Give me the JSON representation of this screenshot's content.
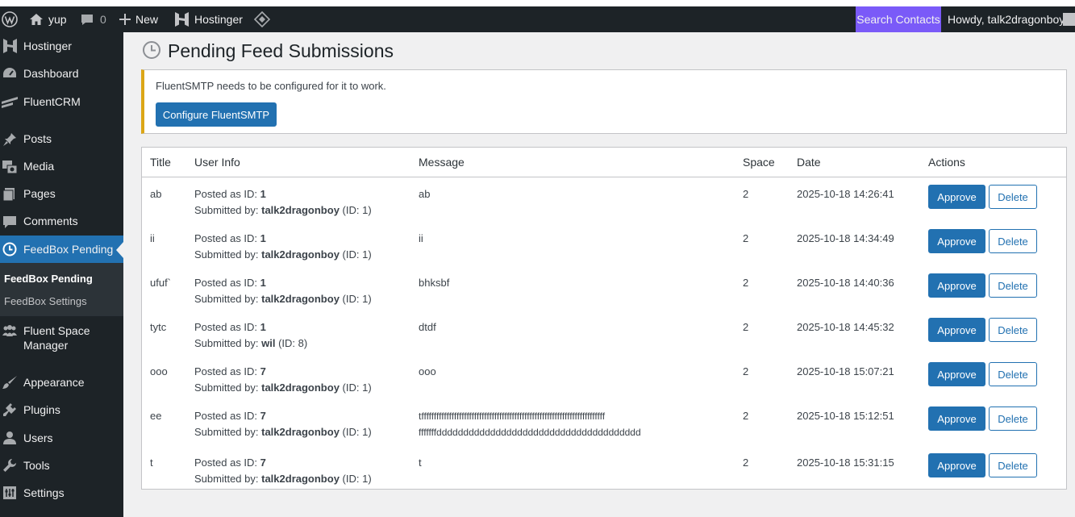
{
  "admin_bar": {
    "site_name": "yup",
    "comments_count": "0",
    "new_label": "New",
    "hostinger_label": "Hostinger",
    "search_contacts_label": "Search Contacts",
    "howdy_label": "Howdy, talk2dragonboy"
  },
  "sidebar": {
    "items": [
      {
        "label": "Hostinger",
        "icon": "hostinger-icon"
      },
      {
        "label": "Dashboard",
        "icon": "dashboard-icon"
      },
      {
        "label": "FluentCRM",
        "icon": "fluentcrm-icon"
      },
      {
        "label": "Posts",
        "icon": "pin-icon"
      },
      {
        "label": "Media",
        "icon": "media-icon"
      },
      {
        "label": "Pages",
        "icon": "pages-icon"
      },
      {
        "label": "Comments",
        "icon": "comments-icon"
      },
      {
        "label": "FeedBox Pending",
        "icon": "clock-icon"
      },
      {
        "label": "Fluent Space Manager",
        "icon": "groups-icon"
      },
      {
        "label": "Appearance",
        "icon": "brush-icon"
      },
      {
        "label": "Plugins",
        "icon": "plugin-icon"
      },
      {
        "label": "Users",
        "icon": "user-icon"
      },
      {
        "label": "Tools",
        "icon": "wrench-icon"
      },
      {
        "label": "Settings",
        "icon": "settings-icon"
      }
    ],
    "submenu": [
      {
        "label": "FeedBox Pending"
      },
      {
        "label": "FeedBox Settings"
      }
    ]
  },
  "page": {
    "title": "Pending Feed Submissions"
  },
  "notice": {
    "text": "FluentSMTP needs to be configured for it to work.",
    "button_label": "Configure FluentSMTP"
  },
  "table": {
    "columns": [
      "Title",
      "User Info",
      "Message",
      "Space",
      "Date",
      "Actions"
    ],
    "posted_prefix": "Posted as ID:",
    "submitted_prefix": "Submitted by:",
    "approve_label": "Approve",
    "delete_label": "Delete",
    "rows": [
      {
        "title": "ab",
        "posted_id": "1",
        "user": "talk2dragonboy",
        "user_id": "(ID: 1)",
        "message": "ab",
        "message2": "",
        "space": "2",
        "date": "2025-10-18 14:26:41"
      },
      {
        "title": "ii",
        "posted_id": "1",
        "user": "talk2dragonboy",
        "user_id": "(ID: 1)",
        "message": "ii",
        "message2": "",
        "space": "2",
        "date": "2025-10-18 14:34:49"
      },
      {
        "title": "ufuf`",
        "posted_id": "1",
        "user": "talk2dragonboy",
        "user_id": "(ID: 1)",
        "message": "bhksbf",
        "message2": "",
        "space": "2",
        "date": "2025-10-18 14:40:36"
      },
      {
        "title": "tytc",
        "posted_id": "1",
        "user": "wil",
        "user_id": "(ID: 8)",
        "message": "dtdf",
        "message2": "",
        "space": "2",
        "date": "2025-10-18 14:45:32"
      },
      {
        "title": "ooo",
        "posted_id": "7",
        "user": "talk2dragonboy",
        "user_id": "(ID: 1)",
        "message": "ooo",
        "message2": "",
        "space": "2",
        "date": "2025-10-18 15:07:21"
      },
      {
        "title": "ee",
        "posted_id": "7",
        "user": "talk2dragonboy",
        "user_id": "(ID: 1)",
        "message": "tfffffffffffffffffffffffffffffffffffffffffffffffffffffffffffffffffffffffff",
        "message2": "fffffffdddddddddddddddddddddddddddddddddddddd",
        "space": "2",
        "date": "2025-10-18 15:12:51"
      },
      {
        "title": "t",
        "posted_id": "7",
        "user": "talk2dragonboy",
        "user_id": "(ID: 1)",
        "message": "t",
        "message2": "",
        "space": "2",
        "date": "2025-10-18 15:31:15"
      }
    ]
  },
  "colors": {
    "admin_bar_bg": "#1d2327",
    "accent": "#2271b1",
    "search_contacts_bg": "#7a5af8",
    "notice_border": "#dba617"
  }
}
